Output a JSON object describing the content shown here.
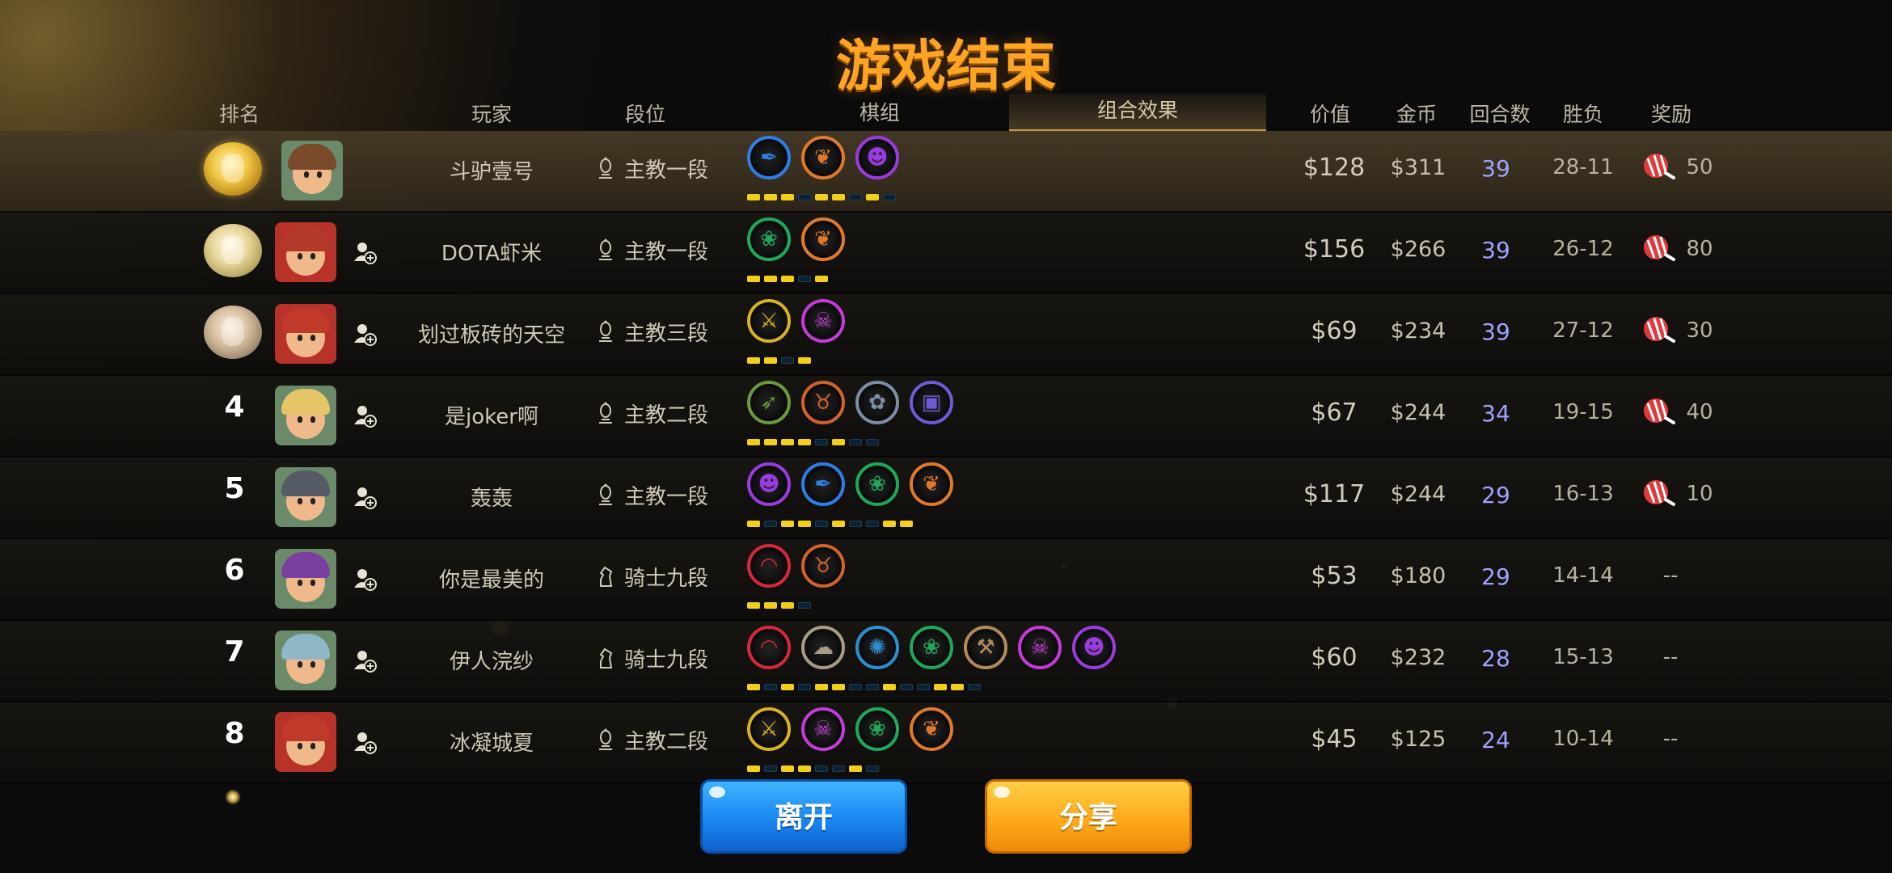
{
  "title": "游戏结束",
  "headers": {
    "rank": "排名",
    "player": "玩家",
    "tier": "段位",
    "pieces": "棋组",
    "synergy": "组合效果",
    "value": "价值",
    "coins": "金币",
    "rounds": "回合数",
    "winloss": "胜负",
    "reward": "奖励"
  },
  "rows": [
    {
      "rank": "",
      "medal": "gold",
      "name": "斗驴壹号",
      "tier": "主教一段",
      "value": "$128",
      "coins": "$311",
      "rounds": "39",
      "winloss": "28-11",
      "reward": "50",
      "synergies": [
        {
          "icon": "feather",
          "color": "#2e7ee8"
        },
        {
          "icon": "leaf",
          "color": "#e07a2a"
        },
        {
          "icon": "mask",
          "color": "#9a3be0"
        }
      ],
      "segments": [
        1,
        1,
        1,
        0,
        1,
        1,
        0,
        1,
        0
      ]
    },
    {
      "rank": "",
      "medal": "silver",
      "name": "DOTA虾米",
      "tier": "主教一段",
      "value": "$156",
      "coins": "$266",
      "rounds": "39",
      "winloss": "26-12",
      "reward": "80",
      "synergies": [
        {
          "icon": "paw",
          "color": "#1ea85a"
        },
        {
          "icon": "leaf",
          "color": "#e07a2a"
        }
      ],
      "segments": [
        1,
        1,
        1,
        0,
        1
      ]
    },
    {
      "rank": "",
      "medal": "bronze",
      "name": "划过板砖的天空",
      "tier": "主教三段",
      "value": "$69",
      "coins": "$234",
      "rounds": "39",
      "winloss": "27-12",
      "reward": "30",
      "synergies": [
        {
          "icon": "claws",
          "color": "#d9b020"
        },
        {
          "icon": "demon",
          "color": "#c43bd9"
        }
      ],
      "segments": [
        1,
        1,
        0,
        1
      ]
    },
    {
      "rank": "4",
      "medal": "",
      "name": "是joker啊",
      "tier": "主教二段",
      "value": "$67",
      "coins": "$244",
      "rounds": "34",
      "winloss": "19-15",
      "reward": "40",
      "synergies": [
        {
          "icon": "bow",
          "color": "#6c9a3a"
        },
        {
          "icon": "horns",
          "color": "#d3622a"
        },
        {
          "icon": "beast",
          "color": "#7a8ea6"
        },
        {
          "icon": "tech",
          "color": "#6e5bd6"
        }
      ],
      "segments": [
        1,
        1,
        1,
        1,
        0,
        1,
        0,
        0
      ]
    },
    {
      "rank": "5",
      "medal": "",
      "name": "轰轰",
      "tier": "主教一段",
      "value": "$117",
      "coins": "$244",
      "rounds": "29",
      "winloss": "16-13",
      "reward": "10",
      "synergies": [
        {
          "icon": "mask",
          "color": "#9a3be0"
        },
        {
          "icon": "feather",
          "color": "#2e7ee8"
        },
        {
          "icon": "paw",
          "color": "#1ea85a"
        },
        {
          "icon": "leaf",
          "color": "#e07a2a"
        }
      ],
      "segments": [
        1,
        0,
        1,
        1,
        0,
        1,
        0,
        0,
        1,
        1
      ]
    },
    {
      "rank": "6",
      "medal": "",
      "name": "你是最美的",
      "tier": "骑士九段",
      "value": "$53",
      "coins": "$180",
      "rounds": "29",
      "winloss": "14-14",
      "reward": "--",
      "synergies": [
        {
          "icon": "arch",
          "color": "#d6283a"
        },
        {
          "icon": "horns",
          "color": "#d3622a"
        }
      ],
      "segments": [
        1,
        1,
        1,
        0
      ]
    },
    {
      "rank": "7",
      "medal": "",
      "name": "伊人浣纱",
      "tier": "骑士九段",
      "value": "$60",
      "coins": "$232",
      "rounds": "28",
      "winloss": "15-13",
      "reward": "--",
      "synergies": [
        {
          "icon": "arch",
          "color": "#d6283a"
        },
        {
          "icon": "spirit",
          "color": "#a89c86"
        },
        {
          "icon": "goblin",
          "color": "#2b8fd0"
        },
        {
          "icon": "paw",
          "color": "#1ea85a"
        },
        {
          "icon": "axe",
          "color": "#b08a5a"
        },
        {
          "icon": "demon",
          "color": "#c43bd9"
        },
        {
          "icon": "mask",
          "color": "#9a3be0"
        }
      ],
      "segments": [
        1,
        0,
        1,
        0,
        1,
        1,
        0,
        0,
        1,
        0,
        0,
        1,
        1,
        0
      ]
    },
    {
      "rank": "8",
      "medal": "",
      "name": "冰凝城夏",
      "tier": "主教二段",
      "value": "$45",
      "coins": "$125",
      "rounds": "24",
      "winloss": "10-14",
      "reward": "--",
      "synergies": [
        {
          "icon": "claws",
          "color": "#d9b020"
        },
        {
          "icon": "demon",
          "color": "#c43bd9"
        },
        {
          "icon": "paw",
          "color": "#1ea85a"
        },
        {
          "icon": "leaf",
          "color": "#e07a2a"
        }
      ],
      "segments": [
        1,
        0,
        1,
        1,
        0,
        0,
        1,
        0
      ]
    }
  ],
  "buttons": {
    "leave": "离开",
    "share": "分享"
  },
  "colors": {
    "title": "#ffa423",
    "round": "#9ea3ff",
    "segment_on": "#f2cf1a",
    "leave": "#1a86f2",
    "share": "#ffa91a"
  }
}
